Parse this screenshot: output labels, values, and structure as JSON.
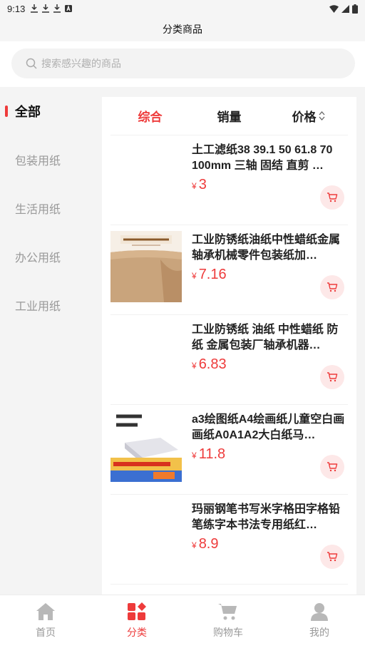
{
  "status_bar": {
    "time": "9:13"
  },
  "title": "分类商品",
  "search": {
    "placeholder": "搜索感兴趣的商品"
  },
  "sidebar": {
    "items": [
      {
        "label": "全部",
        "active": true
      },
      {
        "label": "包装用纸",
        "active": false
      },
      {
        "label": "生活用纸",
        "active": false
      },
      {
        "label": "办公用纸",
        "active": false
      },
      {
        "label": "工业用纸",
        "active": false
      }
    ]
  },
  "sort_tabs": [
    {
      "label": "综合",
      "active": true
    },
    {
      "label": "销量",
      "active": false
    },
    {
      "label": "价格",
      "active": false
    }
  ],
  "products": [
    {
      "title": "土工滤纸38 39.1 50 61.8 70 100mm 三轴 固结 直剪 …",
      "currency": "¥",
      "price": "3"
    },
    {
      "title": "工业防锈纸油纸中性蜡纸金属轴承机械零件包装纸加…",
      "currency": "¥",
      "price": "7.16"
    },
    {
      "title": "工业防锈纸 油纸 中性蜡纸 防纸 金属包装厂轴承机器…",
      "currency": "¥",
      "price": "6.83"
    },
    {
      "title": "a3绘图纸A4绘画纸儿童空白画画纸A0A1A2大白纸马…",
      "currency": "¥",
      "price": "11.8"
    },
    {
      "title": "玛丽钢笔书写米字格田字格铅笔练字本书法专用纸红…",
      "currency": "¥",
      "price": "8.9"
    }
  ],
  "bottom_nav": [
    {
      "label": "首页",
      "icon": "home-icon",
      "active": false
    },
    {
      "label": "分类",
      "icon": "category-icon",
      "active": true
    },
    {
      "label": "购物车",
      "icon": "cart-icon",
      "active": false
    },
    {
      "label": "我的",
      "icon": "user-icon",
      "active": false
    }
  ],
  "colors": {
    "accent": "#ee3b3b",
    "cart_bg": "#fde8e8"
  }
}
